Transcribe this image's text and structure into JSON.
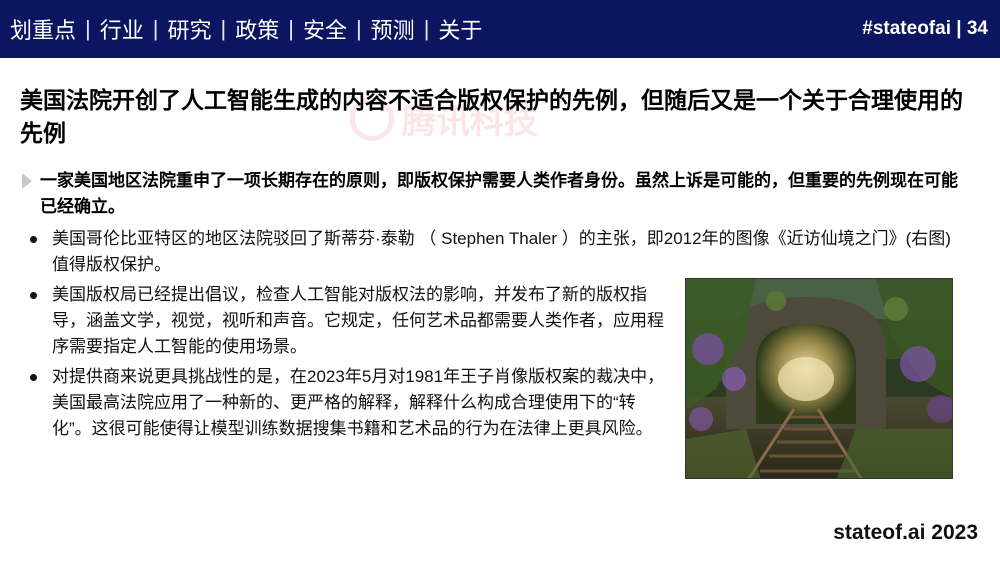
{
  "header": {
    "nav": [
      "划重点",
      "行业",
      "研究",
      "政策",
      "安全",
      "预测",
      "关于"
    ],
    "separator": "|",
    "slide_tag": "#stateofai | 34"
  },
  "watermark": "腾讯科技",
  "title": "美国法院开创了人工智能生成的内容不适合版权保护的先例，但随后又是一个关于合理使用的先例",
  "lead": "一家美国地区法院重申了一项长期存在的原则，即版权保护需要人类作者身份。虽然上诉是可能的，但重要的先例现在可能已经确立。",
  "bullets": [
    "美国哥伦比亚特区的地区法院驳回了斯蒂芬·泰勒 （ Stephen Thaler ）的主张，即2012年的图像《近访仙境之门》(右图)值得版权保护。",
    "美国版权局已经提出倡议，检查人工智能对版权法的影响，并发布了新的版权指导，涵盖文学，视觉，视听和声音。它规定，任何艺术品都需要人类作者，应用程序需要指定人工智能的使用场景。",
    "对提供商来说更具挑战性的是，在2023年5月对1981年王子肖像版权案的裁决中，美国最高法院应用了一种新的、更严格的解释，解释什么构成合理使用下的“转化”。这很可能使得让模型训练数据搜集书籍和艺术品的行为在法律上更具风险。"
  ],
  "footer": "stateof.ai 2023",
  "colors": {
    "header_bg": "#0b1560",
    "header_text": "#ffffff",
    "lead_marker": "#c8c8c8"
  }
}
